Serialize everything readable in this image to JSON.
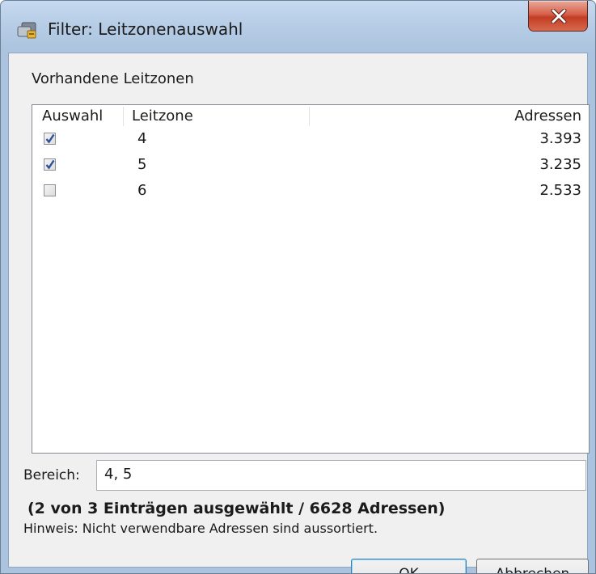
{
  "window": {
    "title": "Filter: Leitzonenauswahl",
    "icon": "filter-app-icon",
    "close_icon": "close-icon"
  },
  "group": {
    "label": "Vorhandene Leitzonen"
  },
  "table": {
    "columns": {
      "select": "Auswahl",
      "zone": "Leitzone",
      "addresses": "Adressen"
    },
    "rows": [
      {
        "checked": true,
        "zone": "4",
        "addresses": "3.393"
      },
      {
        "checked": true,
        "zone": "5",
        "addresses": "3.235"
      },
      {
        "checked": false,
        "zone": "6",
        "addresses": "2.533"
      }
    ]
  },
  "range": {
    "label": "Bereich:",
    "value": "4, 5"
  },
  "summary": "(2 von 3 Einträgen ausgewählt / 6628 Adressen)",
  "hint": "Hinweis: Nicht verwendbare Adressen sind aussortiert.",
  "buttons": {
    "ok": "OK",
    "cancel": "Abbrechen"
  },
  "colors": {
    "titlebar": "#b7cde6",
    "close_button": "#c13d24",
    "dialog_background": "#f0f0f0",
    "checkmark": "#2a4f9f"
  }
}
